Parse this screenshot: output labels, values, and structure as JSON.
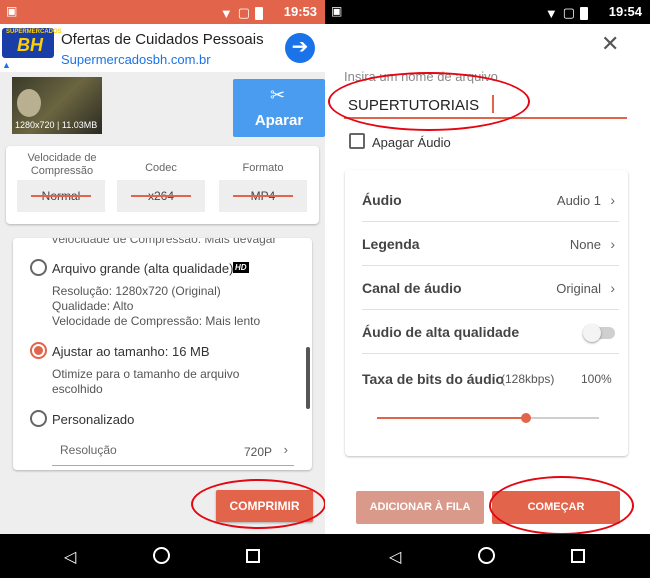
{
  "left": {
    "status_time": "19:53",
    "ad": {
      "logo_top": "SUPERMERCADOS",
      "logo_main": "BH",
      "title": "Ofertas de Cuidados Pessoais",
      "url": "Supermercadosbh.com.br"
    },
    "video": {
      "info": "1280x720 | 11.03MB"
    },
    "trim_label": "Aparar",
    "options": {
      "compression_header": "Velocidade de Compressão",
      "codec_header": "Codec",
      "format_header": "Formato",
      "compression_value": "Normal",
      "codec_value": "x264",
      "format_value": "MP4"
    },
    "quality": {
      "partial_line": "Velocidade de Compressão: Mais devagar",
      "large_label": "Arquivo grande (alta qualidade)",
      "hd_badge": "HD",
      "large_res": "Resolução: 1280x720 (Original)",
      "large_quality": "Qualidade: Alto",
      "large_speed": "Velocidade de Compressão: Mais lento",
      "fit_label": "Ajustar ao tamanho: 16 MB",
      "fit_desc_1": "Otimize para o tamanho de arquivo",
      "fit_desc_2": "escolhido",
      "custom_label": "Personalizado",
      "resolution_label": "Resolução",
      "resolution_value": "720P"
    },
    "compress_button": "COMPRIMIR"
  },
  "right": {
    "status_time": "19:54",
    "filename_label": "Insira um nome de arquivo",
    "filename_value": "SUPERTUTORIAIS",
    "delete_audio_label": "Apagar Áudio",
    "settings": {
      "audio_label": "Áudio",
      "audio_value": "Audio 1",
      "subtitle_label": "Legenda",
      "subtitle_value": "None",
      "channel_label": "Canal de áudio",
      "channel_value": "Original",
      "hq_audio_label": "Áudio de alta qualidade",
      "bitrate_label": "Taxa de bits do áudio",
      "bitrate_value": "(128kbps)",
      "bitrate_percent": "100%",
      "bitrate_level": 0.67
    },
    "queue_button": "ADICIONAR À FILA",
    "start_button": "COMEÇAR"
  },
  "colors": {
    "accent": "#e2644a",
    "trim_button": "#4a9cf0",
    "annotation": "#e30613"
  }
}
